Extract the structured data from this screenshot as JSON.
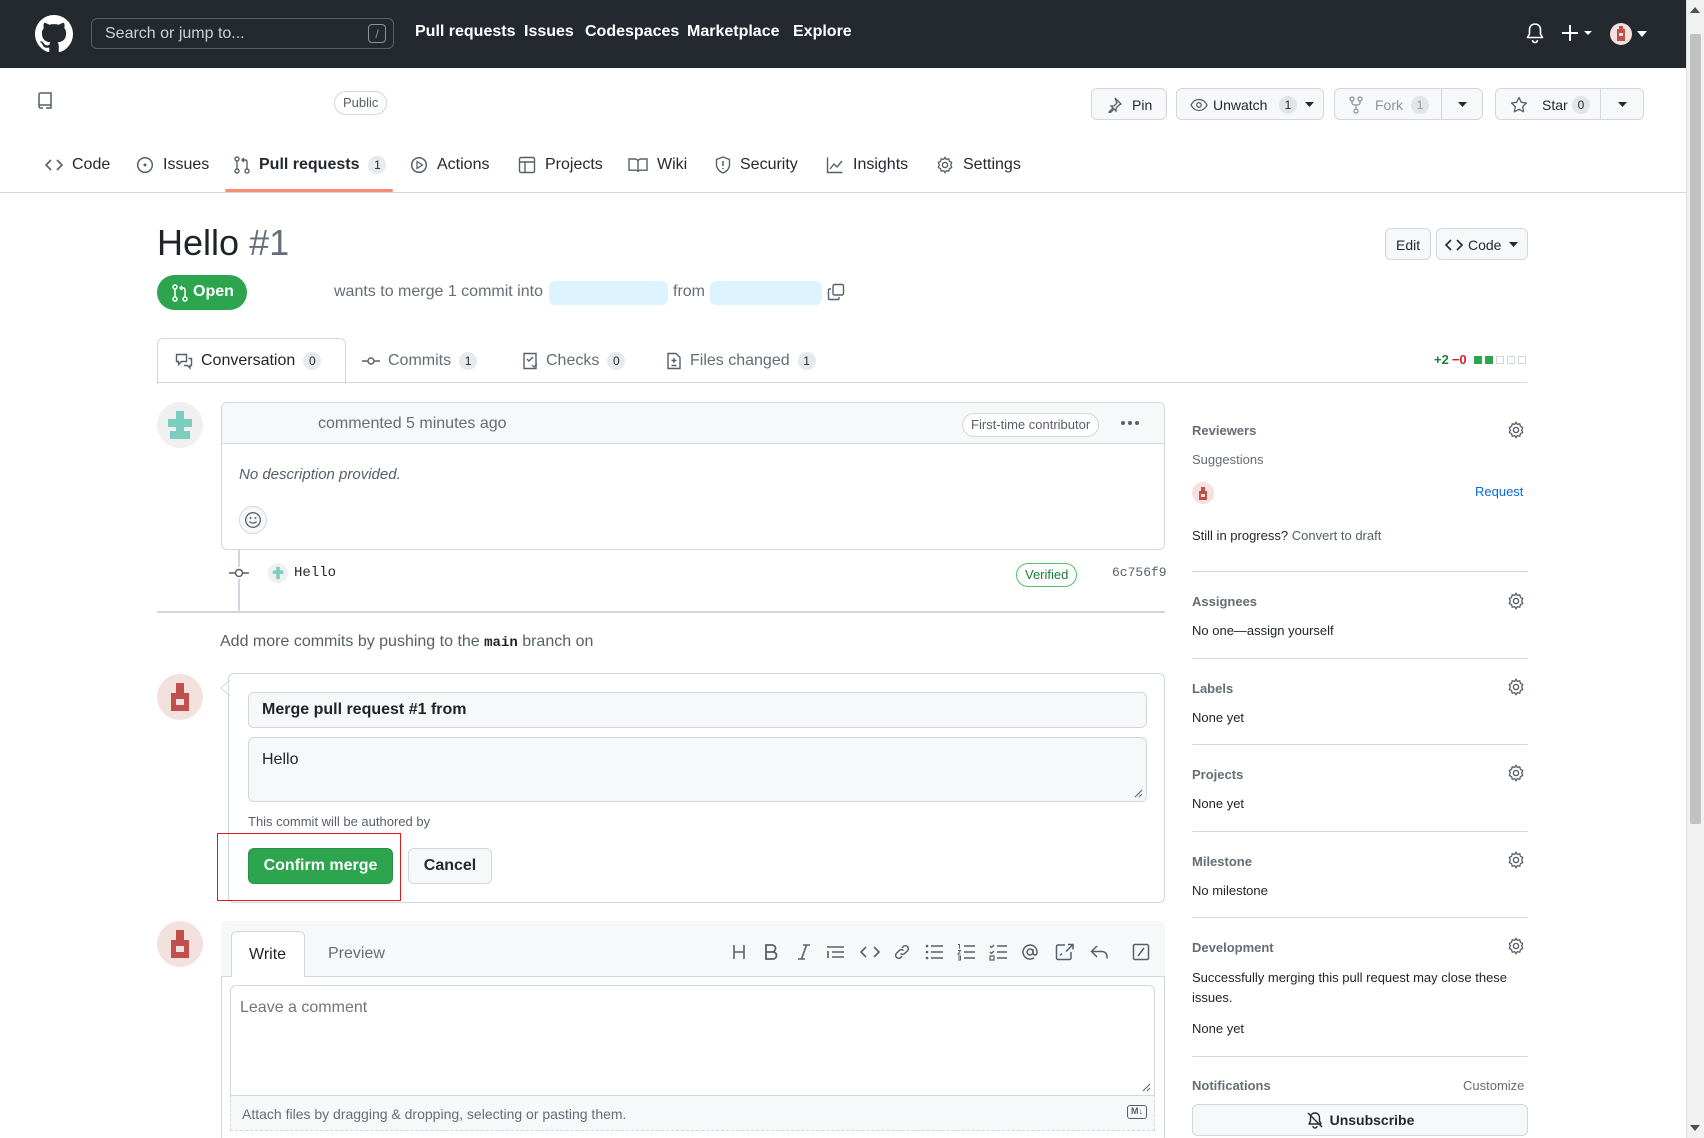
{
  "header": {
    "search_placeholder": "Search or jump to...",
    "search_hotkey": "/",
    "nav": [
      "Pull requests",
      "Issues",
      "Codespaces",
      "Marketplace",
      "Explore"
    ]
  },
  "repo": {
    "visibility": "Public",
    "pin_label": "Pin",
    "unwatch_label": "Unwatch",
    "unwatch_count": "1",
    "fork_label": "Fork",
    "fork_count": "1",
    "star_label": "Star",
    "star_count": "0",
    "tabs": [
      {
        "label": "Code",
        "icon": "code-icon"
      },
      {
        "label": "Issues",
        "icon": "issue-icon"
      },
      {
        "label": "Pull requests",
        "count": "1",
        "icon": "pull-request-icon"
      },
      {
        "label": "Actions",
        "icon": "play-icon"
      },
      {
        "label": "Projects",
        "icon": "table-icon"
      },
      {
        "label": "Wiki",
        "icon": "book-icon"
      },
      {
        "label": "Security",
        "icon": "shield-icon"
      },
      {
        "label": "Insights",
        "icon": "graph-icon"
      },
      {
        "label": "Settings",
        "icon": "gear-icon"
      }
    ]
  },
  "pr": {
    "title": "Hello",
    "number": "#1",
    "edit_label": "Edit",
    "code_label": "Code",
    "state": "Open",
    "merge_text": "wants to merge 1 commit into",
    "from_text": "from",
    "tabs": [
      {
        "label": "Conversation",
        "count": "0"
      },
      {
        "label": "Commits",
        "count": "1"
      },
      {
        "label": "Checks",
        "count": "0"
      },
      {
        "label": "Files changed",
        "count": "1"
      }
    ],
    "additions": "+2",
    "deletions": "−0"
  },
  "timeline": {
    "comment_meta": "commented 5 minutes ago",
    "contributor_badge": "First-time contributor",
    "body": "No description provided.",
    "commit_message": "Hello",
    "verified": "Verified",
    "commit_sha": "6c756f9",
    "push_hint_pre": "Add more commits by pushing to the",
    "push_hint_branch": "main",
    "push_hint_post": "branch on"
  },
  "merge": {
    "title_value": "Merge pull request #1 from",
    "body_value": "Hello",
    "author_note": "This commit will be authored by",
    "confirm_label": "Confirm merge",
    "cancel_label": "Cancel"
  },
  "new_comment": {
    "write_tab": "Write",
    "preview_tab": "Preview",
    "placeholder": "Leave a comment",
    "attach_text": "Attach files by dragging & dropping, selecting or pasting them.",
    "markdown_badge": "M↓"
  },
  "sidebar": {
    "reviewers": "Reviewers",
    "suggestions": "Suggestions",
    "request": "Request",
    "draft_pre": "Still in progress?",
    "draft_link": "Convert to draft",
    "assignees": "Assignees",
    "assignees_value": "No one—assign yourself",
    "labels": "Labels",
    "labels_value": "None yet",
    "projects": "Projects",
    "projects_value": "None yet",
    "milestone": "Milestone",
    "milestone_value": "No milestone",
    "development": "Development",
    "development_desc": "Successfully merging this pull request may close these issues.",
    "development_value": "None yet",
    "notifications": "Notifications",
    "customize": "Customize",
    "unsubscribe": "Unsubscribe"
  },
  "colors": {
    "header_bg": "#24292f",
    "open_green": "#2da44e",
    "link_blue": "#0969da",
    "tab_underline": "#fd8c73",
    "highlight_red": "#e5191c"
  }
}
